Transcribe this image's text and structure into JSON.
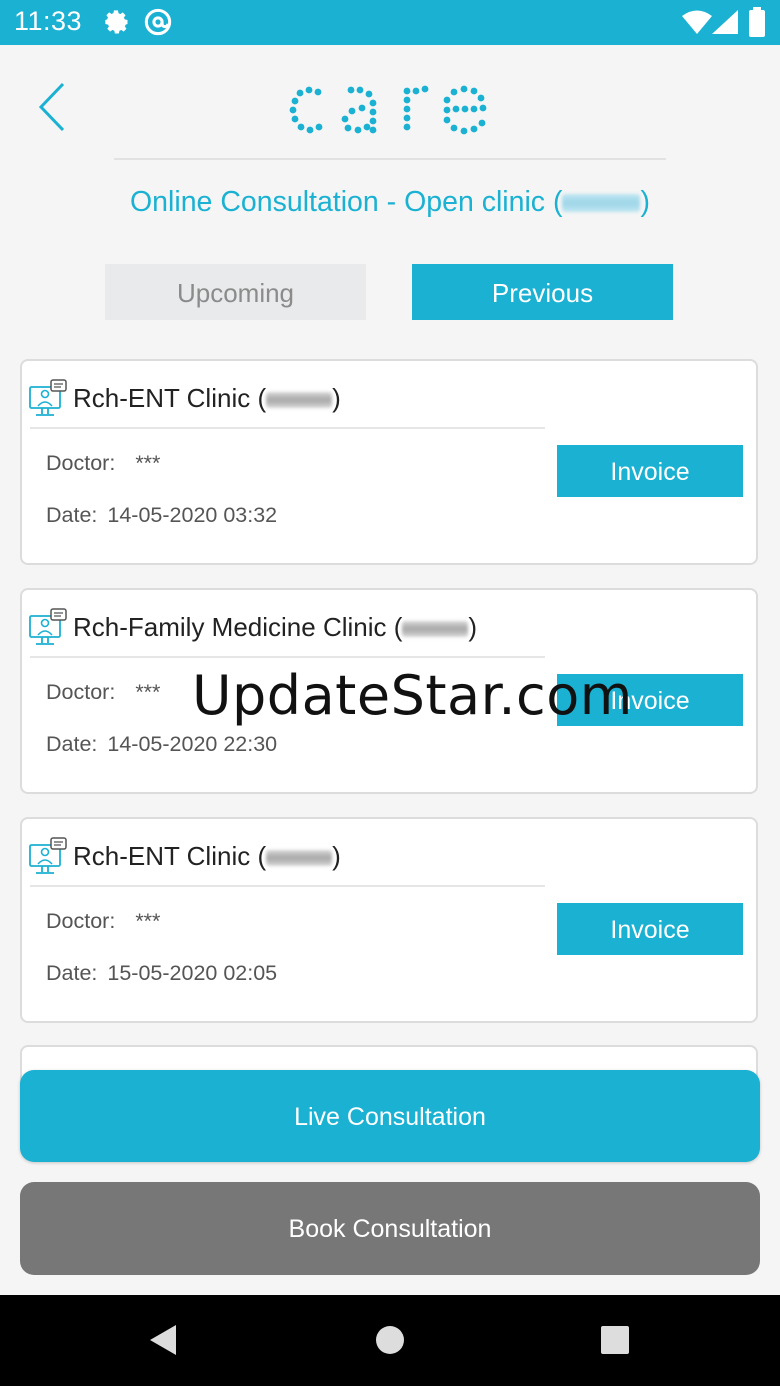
{
  "status_bar": {
    "time": "11:33"
  },
  "header": {
    "logo_text": "care",
    "title": "Online Consultation - Open clinic (",
    "title_close": ")"
  },
  "tabs": [
    {
      "label": "Upcoming"
    },
    {
      "label": "Previous"
    }
  ],
  "consultations": [
    {
      "clinic": "Rch-ENT Clinic (",
      "close": ")",
      "doctor_label": "Doctor:",
      "doctor": "***",
      "date_label": "Date:",
      "date": "14-05-2020 03:32",
      "action": "Invoice"
    },
    {
      "clinic": "Rch-Family Medicine Clinic (",
      "close": ")",
      "doctor_label": "Doctor:",
      "doctor": "***",
      "date_label": "Date:",
      "date": "14-05-2020 22:30",
      "action": "Invoice"
    },
    {
      "clinic": "Rch-ENT Clinic (",
      "close": ")",
      "doctor_label": "Doctor:",
      "doctor": "***",
      "date_label": "Date:",
      "date": "15-05-2020 02:05",
      "action": "Invoice"
    }
  ],
  "buttons": {
    "live": "Live Consultation",
    "book": "Book Consultation"
  },
  "watermark": "UpdateStar.com",
  "colors": {
    "accent": "#1ab1d2",
    "book_button": "#777777",
    "tab_inactive": "#e9eaeb"
  }
}
